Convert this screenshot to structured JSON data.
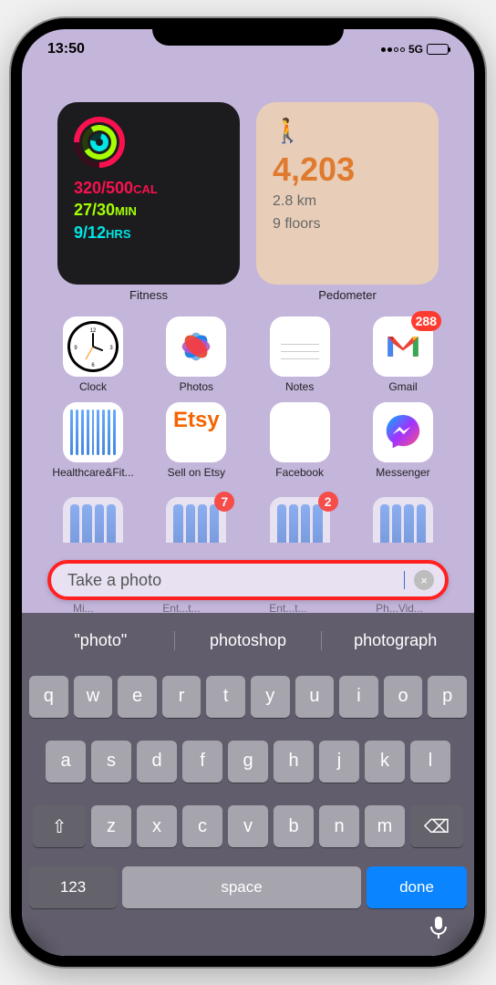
{
  "status": {
    "time": "13:50",
    "network": "5G"
  },
  "widgets": {
    "fitness": {
      "label": "Fitness",
      "cal": "320/500",
      "cal_unit": "CAL",
      "min": "27/30",
      "min_unit": "MIN",
      "hrs": "9/12",
      "hrs_unit": "HRS"
    },
    "pedometer": {
      "label": "Pedometer",
      "steps": "4,203",
      "distance": "2.8 km",
      "floors": "9 floors"
    }
  },
  "apps_row1": [
    {
      "name": "Clock"
    },
    {
      "name": "Photos"
    },
    {
      "name": "Notes"
    },
    {
      "name": "Gmail",
      "badge": "288"
    }
  ],
  "apps_row2": [
    {
      "name": "Healthcare&Fit..."
    },
    {
      "name": "Sell on Etsy"
    },
    {
      "name": "Facebook"
    },
    {
      "name": "Messenger"
    }
  ],
  "peek_badges": [
    "7",
    "2"
  ],
  "search": {
    "value": "Take a photo",
    "clear": "×"
  },
  "trunc_labels": [
    "Mi...",
    "Ent...t...",
    "Ent...t...",
    "Ph...Vid..."
  ],
  "suggestions": [
    "\"photo\"",
    "photoshop",
    "photograph"
  ],
  "kb": {
    "row1": [
      "q",
      "w",
      "e",
      "r",
      "t",
      "y",
      "u",
      "i",
      "o",
      "p"
    ],
    "row2": [
      "a",
      "s",
      "d",
      "f",
      "g",
      "h",
      "j",
      "k",
      "l"
    ],
    "row3": [
      "z",
      "x",
      "c",
      "v",
      "b",
      "n",
      "m"
    ],
    "shift": "⇧",
    "del": "⌫",
    "more": "123",
    "space": "space",
    "done": "done",
    "mic": "🎤"
  }
}
